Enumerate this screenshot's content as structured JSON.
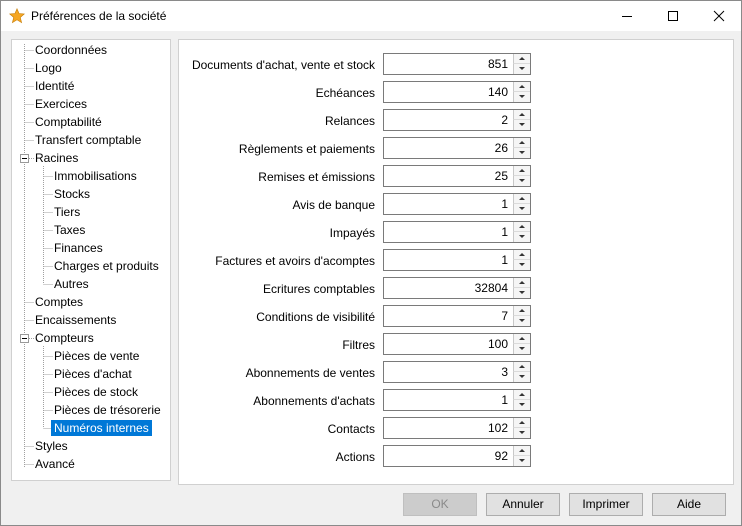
{
  "window": {
    "title": "Préférences de la société"
  },
  "tree": {
    "items": [
      {
        "label": "Coordonnées"
      },
      {
        "label": "Logo"
      },
      {
        "label": "Identité"
      },
      {
        "label": "Exercices"
      },
      {
        "label": "Comptabilité"
      },
      {
        "label": "Transfert comptable"
      },
      {
        "label": "Racines",
        "expanded": true
      },
      {
        "label": "Immobilisations"
      },
      {
        "label": "Stocks"
      },
      {
        "label": "Tiers"
      },
      {
        "label": "Taxes"
      },
      {
        "label": "Finances"
      },
      {
        "label": "Charges et produits"
      },
      {
        "label": "Autres"
      },
      {
        "label": "Comptes"
      },
      {
        "label": "Encaissements"
      },
      {
        "label": "Compteurs",
        "expanded": true
      },
      {
        "label": "Pièces de vente"
      },
      {
        "label": "Pièces d'achat"
      },
      {
        "label": "Pièces de stock"
      },
      {
        "label": "Pièces de trésorerie"
      },
      {
        "label": "Numéros internes",
        "selected": true
      },
      {
        "label": "Styles"
      },
      {
        "label": "Avancé"
      }
    ]
  },
  "counters": [
    {
      "label": "Documents d'achat, vente et stock",
      "value": "851"
    },
    {
      "label": "Echéances",
      "value": "140"
    },
    {
      "label": "Relances",
      "value": "2"
    },
    {
      "label": "Règlements et paiements",
      "value": "26"
    },
    {
      "label": "Remises et émissions",
      "value": "25"
    },
    {
      "label": "Avis de banque",
      "value": "1"
    },
    {
      "label": "Impayés",
      "value": "1"
    },
    {
      "label": "Factures et avoirs d'acomptes",
      "value": "1"
    },
    {
      "label": "Ecritures comptables",
      "value": "32804"
    },
    {
      "label": "Conditions de visibilité",
      "value": "7"
    },
    {
      "label": "Filtres",
      "value": "100"
    },
    {
      "label": "Abonnements de ventes",
      "value": "3"
    },
    {
      "label": "Abonnements d'achats",
      "value": "1"
    },
    {
      "label": "Contacts",
      "value": "102"
    },
    {
      "label": "Actions",
      "value": "92"
    }
  ],
  "buttons": {
    "ok": "OK",
    "cancel": "Annuler",
    "print": "Imprimer",
    "help": "Aide"
  },
  "colors": {
    "selection": "#0078d7",
    "icon_star": "#f5a623"
  }
}
